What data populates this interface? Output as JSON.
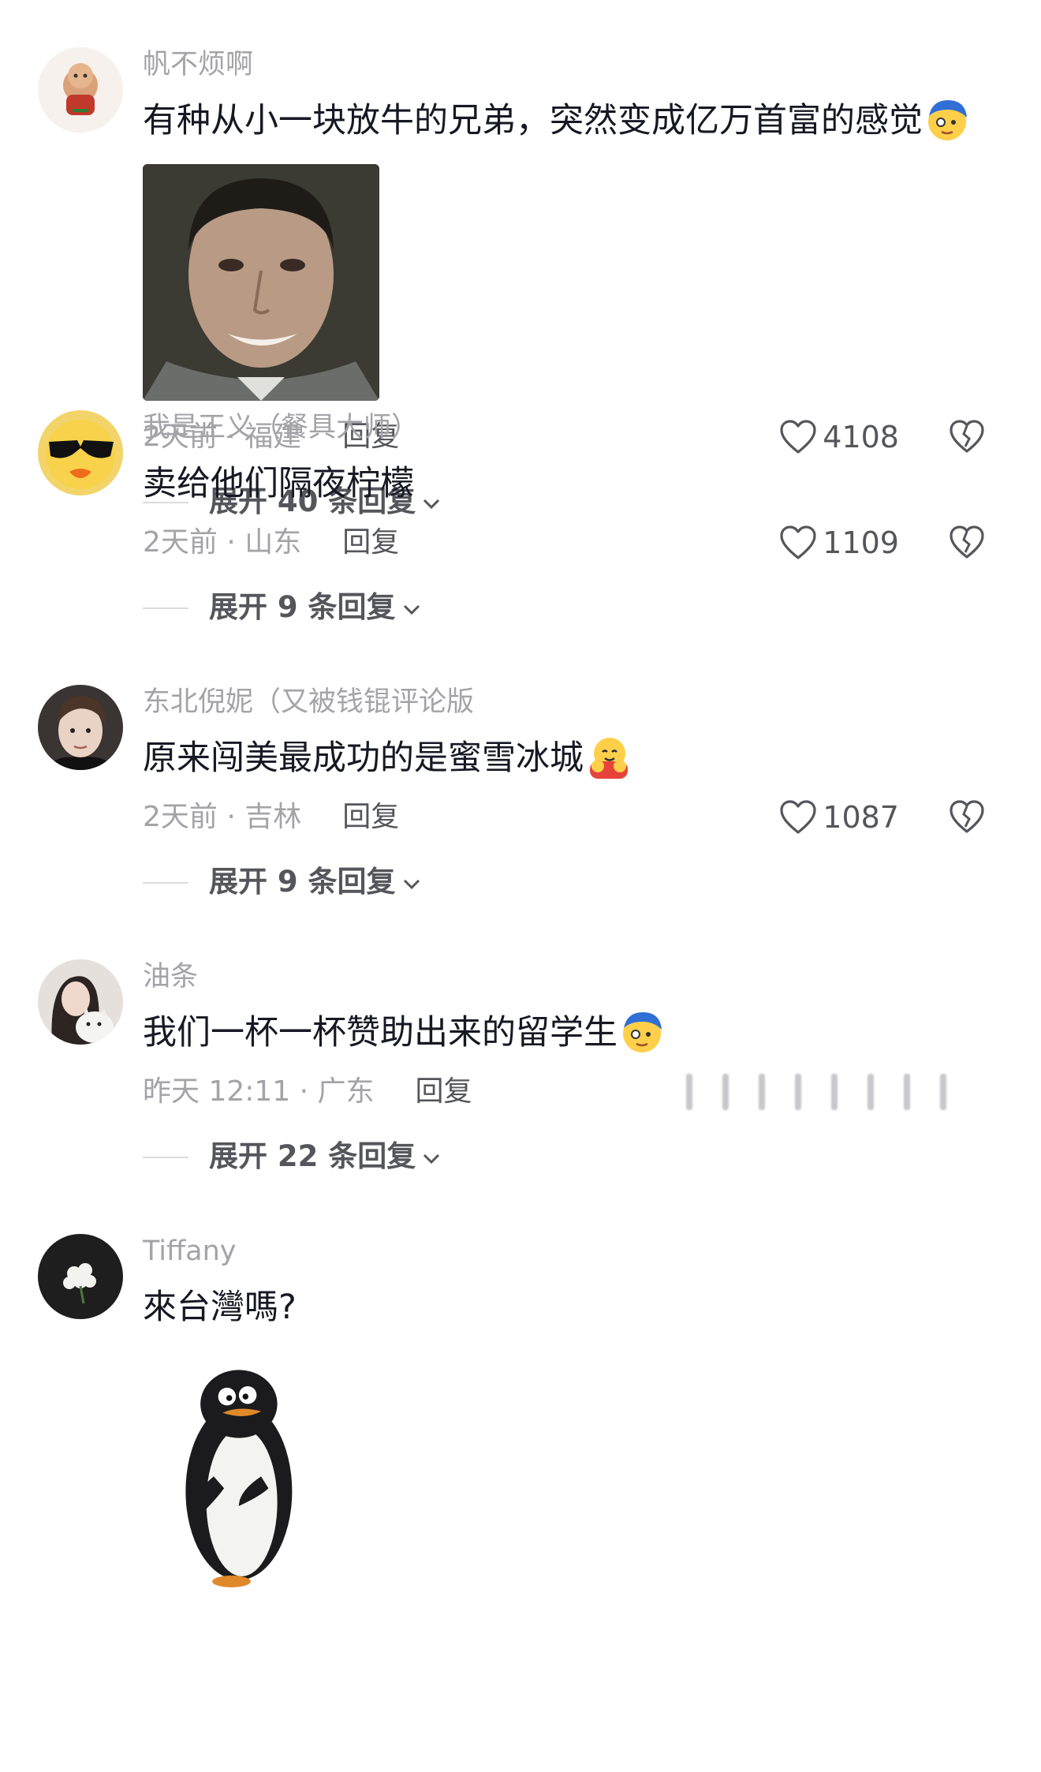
{
  "comments": [
    {
      "username": "帆不烦啊",
      "text": "有种从小一块放牛的兄弟，突然变成亿万首富的感觉",
      "time_location": "2天前 · 福建",
      "reply_label": "回复",
      "likes": "4108",
      "expand": "展开 40 条回复",
      "emoji": "shy-face-emoji"
    },
    {
      "username": "我是正义（餐具大师）",
      "text": "卖给他们隔夜柠檬",
      "time_location": "2天前 · 山东",
      "reply_label": "回复",
      "likes": "1109",
      "expand": "展开 9 条回复"
    },
    {
      "username": "东北倪妮（又被钱锟评论版",
      "text": "原来闯美最成功的是蜜雪冰城",
      "time_location": "2天前 · 吉林",
      "reply_label": "回复",
      "likes": "1087",
      "expand": "展开 9 条回复",
      "emoji": "hug-emoji"
    },
    {
      "username": "油条",
      "text": "我们一杯一杯赞助出来的留学生",
      "time_location": "昨天 12:11 · 广东",
      "reply_label": "回复",
      "expand": "展开 22 条回复",
      "emoji": "shy-face-emoji"
    },
    {
      "username": "Tiffany",
      "text": "來台灣嗎?"
    }
  ],
  "icons": {
    "like": "heart-outline-icon",
    "dislike": "broken-heart-icon",
    "expand": "chevron-down-icon"
  },
  "colors": {
    "username": "#a3a3a8",
    "text": "#161823",
    "secondary": "#55565c"
  }
}
